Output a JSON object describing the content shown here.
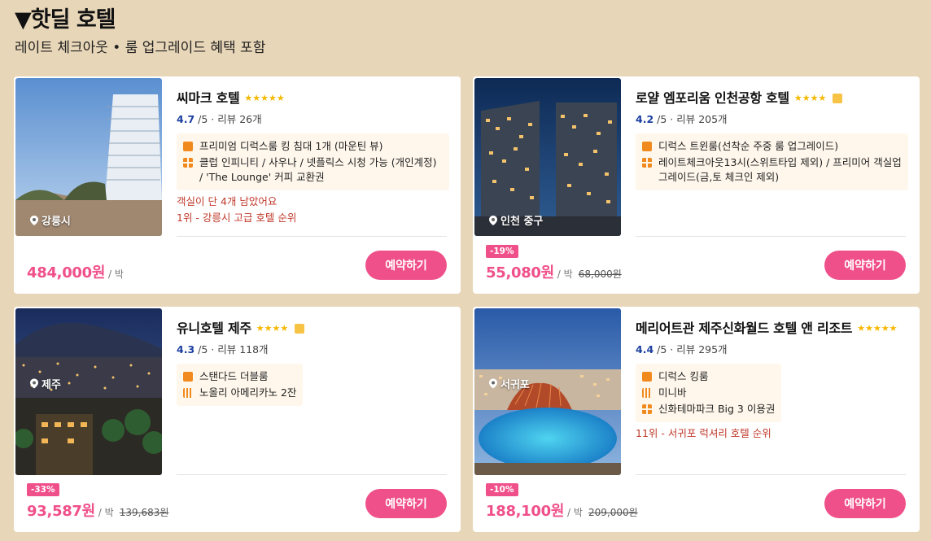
{
  "header": {
    "title": "▼핫딜 호텔",
    "subtitle": "레이트 체크아웃 • 룸 업그레이드 혜택 포함"
  },
  "colors": {
    "accent": "#f0508a",
    "background": "#e8d6b8",
    "rating": "#1b3fa0",
    "alert": "#c0392b",
    "perk_icon": "#f08a1f"
  },
  "hotels": [
    {
      "name": "씨마크 호텔",
      "stars": "★★★★★",
      "rating": "4.7",
      "rating_suffix": " /5 · 리뷰 26개",
      "location": "강릉시",
      "perks": [
        {
          "icon": "room-icon",
          "text": "프리미엄 디럭스룸 킹 침대 1개 (마운틴 뷰)"
        },
        {
          "icon": "grid-icon",
          "text": "클럽 인피니티 / 사우나 / 넷플릭스 시청 가능 (개인계정) / 'The Lounge' 커피 교환권"
        }
      ],
      "alerts": [
        "객실이 단 4개 남았어요",
        "1위 - 강릉시 고급 호텔 순위"
      ],
      "discount": "",
      "price": "484,000원",
      "unit": " / 박",
      "old_price": "",
      "button": "예약하기"
    },
    {
      "name": "로얄 엠포리움 인천공항 호텔",
      "stars": "★★★★",
      "rating": "4.2",
      "rating_suffix": " /5 · 리뷰 205개",
      "location": "인천 중구",
      "perks": [
        {
          "icon": "room-icon",
          "text": "디럭스 트윈룸(선착순 주중 룸 업그레이드)"
        },
        {
          "icon": "grid-icon",
          "text": "레이트체크아웃13시(스위트타입 제외) / 프리미어 객실업그레이드(금,토 체크인 제외)"
        }
      ],
      "alerts": [],
      "discount": "-19%",
      "price": "55,080원",
      "unit": " / 박",
      "old_price": "68,000원",
      "button": "예약하기"
    },
    {
      "name": "유니호텔 제주",
      "stars": "★★★★",
      "rating": "4.3",
      "rating_suffix": " /5 · 리뷰 118개",
      "location": "제주",
      "perks": [
        {
          "icon": "room-icon",
          "text": "스탠다드 더블룸"
        },
        {
          "icon": "food-icon",
          "text": "노올리 아메리카노 2잔"
        }
      ],
      "alerts": [],
      "discount": "-33%",
      "price": "93,587원",
      "unit": " / 박",
      "old_price": "139,683원",
      "button": "예약하기"
    },
    {
      "name": "메리어트관 제주신화월드 호텔 앤 리조트",
      "stars": "★★★★★",
      "rating": "4.4",
      "rating_suffix": " /5 · 리뷰 295개",
      "location": "서귀포",
      "perks": [
        {
          "icon": "room-icon",
          "text": "디럭스 킹룸"
        },
        {
          "icon": "food-icon",
          "text": "미니바"
        },
        {
          "icon": "grid-icon",
          "text": "신화테마파크 Big 3 이용권"
        }
      ],
      "alerts": [
        "11위 - 서귀포 럭셔리 호텔 순위"
      ],
      "discount": "-10%",
      "price": "188,100원",
      "unit": " / 박",
      "old_price": "209,000원",
      "button": "예약하기"
    }
  ]
}
